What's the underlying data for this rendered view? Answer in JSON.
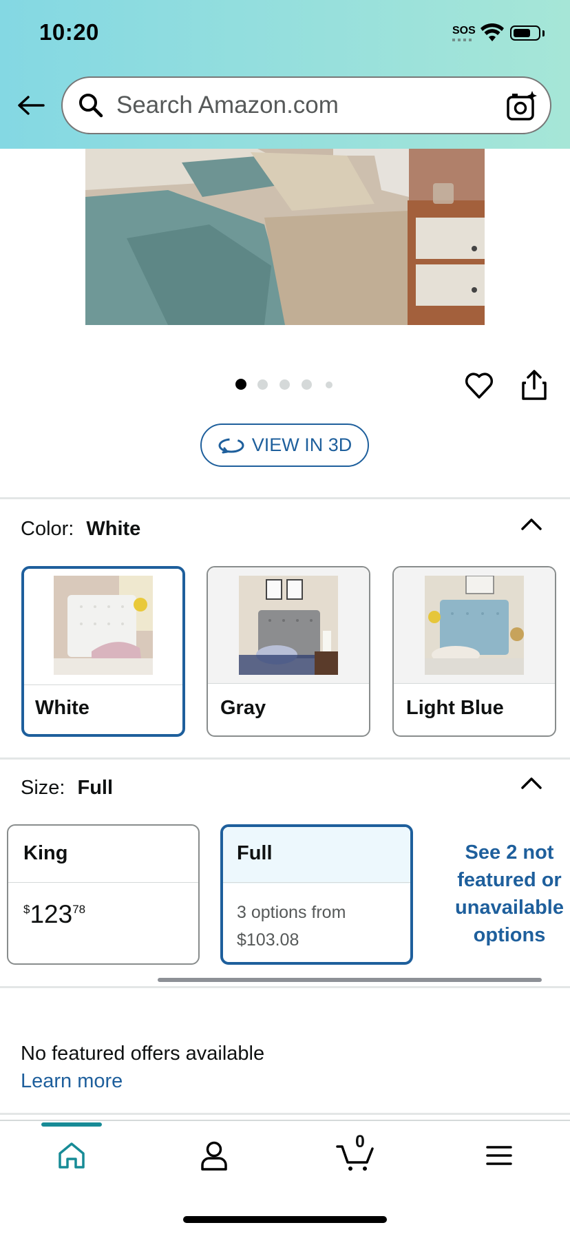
{
  "status_bar": {
    "time": "10:20",
    "sos": "SOS"
  },
  "search": {
    "placeholder": "Search Amazon.com"
  },
  "gallery": {
    "image_count": 5,
    "active_index": 0,
    "view_3d_label": "VIEW IN 3D"
  },
  "color": {
    "label": "Color:",
    "selected": "White",
    "options": [
      {
        "label": "White"
      },
      {
        "label": "Gray"
      },
      {
        "label": "Light Blue"
      }
    ]
  },
  "size": {
    "label": "Size:",
    "selected": "Full",
    "options": [
      {
        "name": "King",
        "price_whole": "123",
        "price_fraction": "78",
        "currency": "$"
      },
      {
        "name": "Full",
        "options_line1": "3 options from",
        "options_line2": "$103.08"
      }
    ],
    "see_more": [
      "See 2 not",
      "featured or",
      "unavailable",
      "options"
    ]
  },
  "offers": {
    "message": "No featured offers available",
    "learn_more": "Learn more"
  },
  "bottom_nav": {
    "cart_count": "0",
    "items": [
      "home-icon",
      "account-icon",
      "cart-icon",
      "menu-icon"
    ]
  },
  "colors": {
    "header_start": "#84d8e3",
    "header_end": "#a6e6d7",
    "link": "#1e5f9c",
    "nav_accent": "#178b96"
  }
}
